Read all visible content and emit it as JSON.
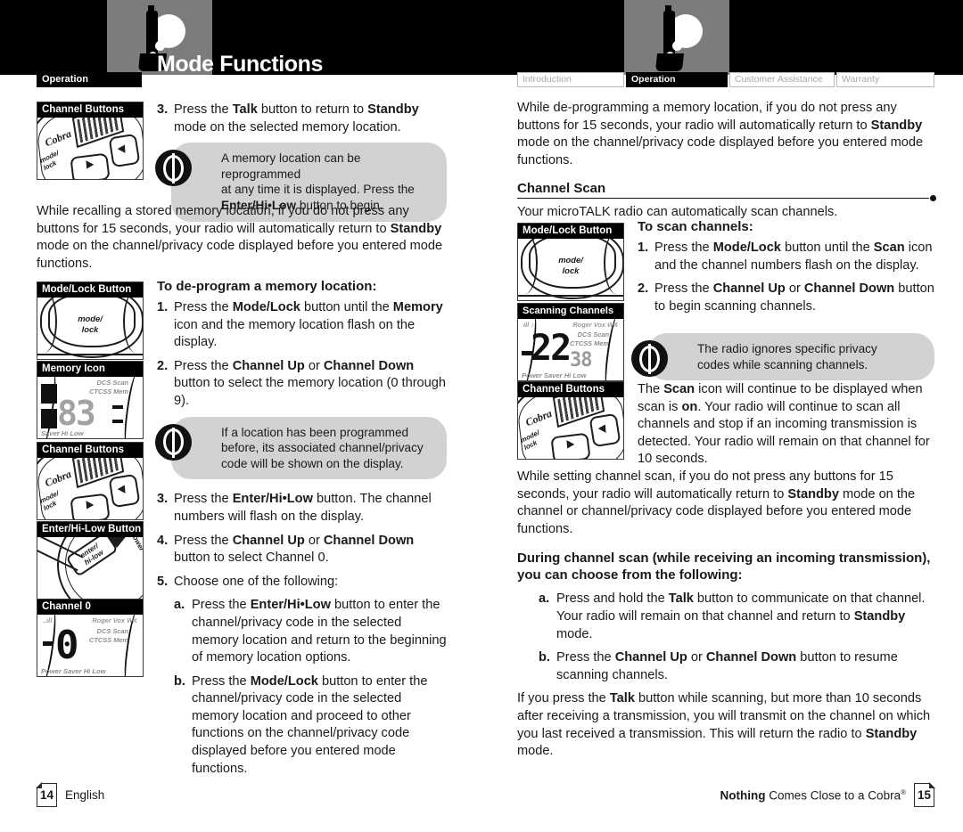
{
  "document": {
    "title": "Mode Functions",
    "section_tag": "Operation"
  },
  "tabs": [
    {
      "label": "Introduction",
      "active": false
    },
    {
      "label": "Operation",
      "active": true
    },
    {
      "label": "Customer Assistance",
      "active": false
    },
    {
      "label": "Warranty",
      "active": false
    }
  ],
  "left_page": {
    "step3": {
      "num": "3.",
      "text_a": "Press the ",
      "bold_a": "Talk",
      "text_b": " button to return to ",
      "bold_b": "Standby",
      "text_c": " mode on the selected memory location."
    },
    "tip1": {
      "line1": "A memory location can be reprogrammed",
      "line2": "at any time it is displayed. Press the",
      "bold": "Enter/Hi•Low",
      "line3_tail": " button to begin."
    },
    "para_recall": {
      "a": "While recalling a stored memory location, if you do not press any buttons for 15 seconds, your radio will automatically return to ",
      "bold": "Standby",
      "b": " mode on the channel/privacy code displayed before you entered mode functions."
    },
    "heading_deprogram": "To de-program a memory location:",
    "steps": [
      {
        "num": "1.",
        "a": "Press the ",
        "b1": "Mode/Lock",
        "b": " button until the ",
        "b2": "Memory",
        "c": " icon and the memory location flash on the display."
      },
      {
        "num": "2.",
        "a": "Press the ",
        "b1": "Channel Up",
        "b": " or ",
        "b2": "Channel Down",
        "c": " button to select the memory location (0 through 9)."
      },
      {
        "num": "3.",
        "a": "Press the ",
        "b1": "Enter/Hi•Low",
        "b": " button. The channel numbers will flash on the display.",
        "b2": "",
        "c": ""
      },
      {
        "num": "4.",
        "a": "Press the ",
        "b1": "Channel Up",
        "b": " or ",
        "b2": "Channel Down",
        "c": " button to select Channel 0."
      },
      {
        "num": "5.",
        "a": "Choose one of the following:",
        "b1": "",
        "b": "",
        "b2": "",
        "c": ""
      }
    ],
    "tip2": {
      "line1": "If a location has been programmed",
      "line2": "before, its associated channel/privacy",
      "line3": "code will be shown on the display."
    },
    "substeps": [
      {
        "num": "a.",
        "a": "Press the ",
        "b1": "Enter/Hi•Low",
        "c": " button to enter the channel/privacy code in the selected memory location and return to the beginning of memory location options."
      },
      {
        "num": "b.",
        "a": "Press the ",
        "b1": "Mode/Lock",
        "c": " button to enter the channel/privacy code in the selected memory location and proceed to other functions on the channel/privacy code displayed before you entered mode functions."
      }
    ],
    "figures": [
      {
        "caption": "Channel Buttons",
        "kind": "channel-buttons"
      },
      {
        "caption": "Mode/Lock Button",
        "kind": "mode-lock"
      },
      {
        "caption": "Memory Icon",
        "kind": "lcd-memory",
        "digits": "83",
        "tags_top": "DCS  Scan",
        "tags_bottom": "CTCSS Mem",
        "footer": "Saver  Hi Low"
      },
      {
        "caption": "Channel Buttons",
        "kind": "channel-buttons"
      },
      {
        "caption": "Enter/Hi-Low Button",
        "kind": "enter-hilow"
      },
      {
        "caption": "Channel 0",
        "kind": "lcd-channel0",
        "digits": "0",
        "tags_top": "DCS  Scan",
        "tags_bottom": "CTCSS Mem",
        "top_row": "Roger  Vox WX",
        "footer": "Power Saver  Hi Low"
      }
    ],
    "page_number": "14",
    "page_language": "English"
  },
  "right_page": {
    "para_deprog": {
      "a": "While de-programming a memory location, if you do not press any buttons for 15 seconds, your radio will automatically return to ",
      "bold": "Standby",
      "b": " mode on the channel/privacy code displayed before you entered mode functions."
    },
    "scan_heading": "Channel Scan",
    "scan_intro": "Your microTALK radio can automatically scan channels.",
    "heading_to_scan": "To scan channels:",
    "steps": [
      {
        "num": "1.",
        "a": "Press the ",
        "b1": "Mode/Lock",
        "b": " button until the ",
        "b2": "Scan",
        "c": " icon and the channel numbers flash on the display."
      },
      {
        "num": "2.",
        "a": "Press the ",
        "b1": "Channel Up",
        "b": " or ",
        "b2": "Channel Down",
        "c": " button to begin scanning channels."
      }
    ],
    "tip": {
      "line1": "The radio ignores specific privacy",
      "line2": "codes while scanning channels."
    },
    "para_scan_icon": {
      "a": "The ",
      "b1": "Scan",
      "b": " icon will continue to be displayed when scan is ",
      "b2": "on",
      "c": ". Your radio will continue to scan all channels and stop if an incoming transmission is detected. Your radio will remain on that channel for 10 seconds."
    },
    "para_setting": {
      "a": "While setting channel scan, if you do not press any buttons for 15 seconds, your radio will automatically return to ",
      "bold": "Standby",
      "b": " mode on the channel or channel/privacy code displayed before you entered mode functions."
    },
    "heading_during": {
      "line1": "During channel scan (while receiving an incoming transmission),",
      "line2": "you can choose from the following:"
    },
    "substeps": [
      {
        "num": "a.",
        "a": "Press and hold the ",
        "b1": "Talk",
        "b": " button to communicate on that channel. Your radio will remain on that channel and return to ",
        "b2": "Standby",
        "c": " mode."
      },
      {
        "num": "b.",
        "a": "Press the ",
        "b1": "Channel Up",
        "b": " or ",
        "b2": "Channel Down",
        "c": " button to resume scanning channels."
      }
    ],
    "para_final": {
      "a": "If you press the ",
      "b1": "Talk",
      "b": " button while scanning, but more than 10 seconds after receiving a transmission, you will transmit on the channel on which you last received a transmission. This will return the radio to ",
      "b2": "Standby",
      "c": " mode."
    },
    "figures": [
      {
        "caption": "Mode/Lock Button",
        "kind": "mode-lock"
      },
      {
        "caption": "Scanning Channels",
        "kind": "lcd-scan",
        "digits": "22",
        "sub": "38",
        "tags_top": "DCS  Scan",
        "tags_bottom": "CTCSS Mem",
        "top_row": "Roger  Vox WX",
        "footer": "Power Saver  Hi Low"
      },
      {
        "caption": "Channel Buttons",
        "kind": "channel-buttons"
      }
    ],
    "page_number": "15",
    "footer_text_bold": "Nothing",
    "footer_text_rest": " Comes Close to a Cobra"
  },
  "button_labels": {
    "mode_lock_line1": "mode/",
    "mode_lock_line2": "lock",
    "enter_line1": "enter/",
    "enter_line2": "hi-low",
    "power": "Power",
    "brand": "Cobra"
  },
  "colors": {
    "ink": "#1a1a1a",
    "band": "#000000",
    "logo_box": "#7c7c7c",
    "tip_bg": "#d2d2d2",
    "tab_inactive_text": "#a8a8a8"
  }
}
